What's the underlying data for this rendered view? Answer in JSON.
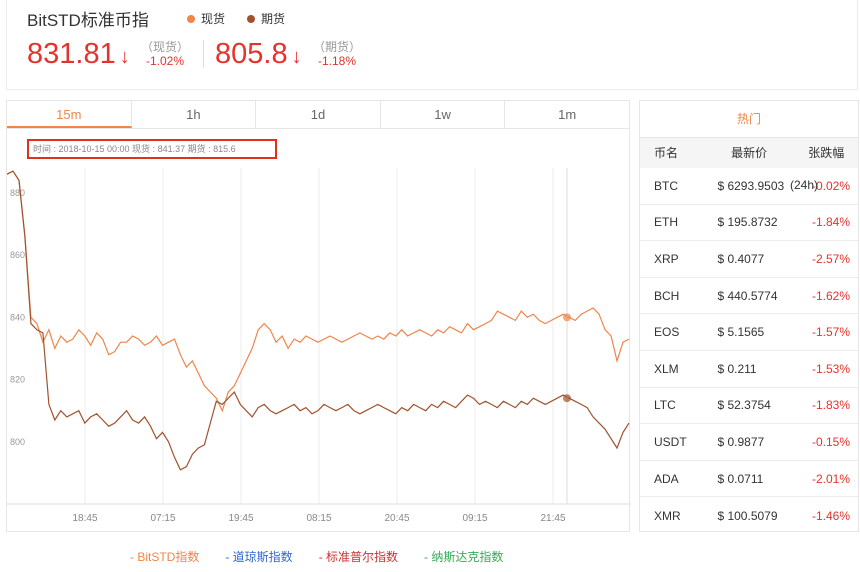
{
  "header": {
    "title": "BitSTD标准币指",
    "legend": [
      {
        "label": "现货",
        "color": "#f0844a"
      },
      {
        "label": "期货",
        "color": "#a0522d"
      }
    ],
    "spot": {
      "value": "831.81",
      "arrow": "↓",
      "label": "（现货）",
      "pct": "-1.02%"
    },
    "futures": {
      "value": "805.8",
      "arrow": "↓",
      "label": "（期货）",
      "pct": "-1.18%"
    }
  },
  "tabs": [
    {
      "label": "15m",
      "active": true
    },
    {
      "label": "1h",
      "active": false
    },
    {
      "label": "1d",
      "active": false
    },
    {
      "label": "1w",
      "active": false
    },
    {
      "label": "1m",
      "active": false
    }
  ],
  "tooltip": "时间 : 2018-10-15 00:00   现货 : 841.37   期货 : 815.6",
  "bottom_legend": [
    {
      "label": "-  BitSTD指数",
      "color": "#f0844a"
    },
    {
      "label": "-  道琼斯指数",
      "color": "#3366cc"
    },
    {
      "label": "-  标准普尔指数",
      "color": "#cc3333"
    },
    {
      "label": "-  纳斯达克指数",
      "color": "#33aa55"
    }
  ],
  "hot": {
    "title": "热门",
    "columns": [
      "币名",
      "最新价",
      "张跌幅"
    ],
    "volume_label": "(24h)",
    "rows": [
      {
        "name": "BTC",
        "price": "$ 6293.9503",
        "change": "-0.02%"
      },
      {
        "name": "ETH",
        "price": "$ 195.8732",
        "change": "-1.84%"
      },
      {
        "name": "XRP",
        "price": "$ 0.4077",
        "change": "-2.57%"
      },
      {
        "name": "BCH",
        "price": "$ 440.5774",
        "change": "-1.62%"
      },
      {
        "name": "EOS",
        "price": "$ 5.1565",
        "change": "-1.57%"
      },
      {
        "name": "XLM",
        "price": "$ 0.211",
        "change": "-1.53%"
      },
      {
        "name": "LTC",
        "price": "$ 52.3754",
        "change": "-1.83%"
      },
      {
        "name": "USDT",
        "price": "$ 0.9877",
        "change": "-0.15%"
      },
      {
        "name": "ADA",
        "price": "$ 0.0711",
        "change": "-2.01%"
      },
      {
        "name": "XMR",
        "price": "$ 100.5079",
        "change": "-1.46%"
      }
    ]
  },
  "chart_data": {
    "type": "line",
    "x_ticks": [
      "18:45",
      "07:15",
      "19:45",
      "08:15",
      "20:45",
      "09:15",
      "21:45"
    ],
    "y_ticks": [
      800,
      820,
      840,
      860,
      880
    ],
    "ylim": [
      780,
      888
    ],
    "grid": "vertical",
    "series": [
      {
        "name": "现货",
        "color": "#f0844a",
        "values": [
          886,
          887,
          884,
          866,
          840,
          838,
          832,
          836,
          830,
          834,
          832,
          833,
          836,
          834,
          831,
          835,
          833,
          828,
          829,
          832,
          832,
          834,
          833,
          831,
          832,
          834,
          831,
          832,
          833,
          828,
          824,
          826,
          822,
          818,
          816,
          814,
          810,
          816,
          818,
          822,
          826,
          830,
          836,
          838,
          836,
          832,
          834,
          830,
          833,
          832,
          834,
          833,
          832,
          833,
          834,
          833,
          832,
          833,
          834,
          835,
          834,
          833,
          834,
          833,
          835,
          834,
          836,
          834,
          835,
          836,
          835,
          834,
          836,
          835,
          837,
          836,
          835,
          838,
          836,
          837,
          838,
          839,
          842,
          841,
          840,
          839,
          842,
          840,
          841,
          839,
          838,
          839,
          840,
          841,
          840,
          839,
          841,
          842,
          843,
          841,
          836,
          834,
          826,
          832,
          833
        ]
      },
      {
        "name": "期货",
        "color": "#a0522d",
        "values": [
          886,
          887,
          884,
          866,
          838,
          836,
          835,
          812,
          807,
          810,
          808,
          809,
          810,
          806,
          808,
          809,
          807,
          805,
          806,
          808,
          810,
          807,
          806,
          808,
          805,
          801,
          803,
          800,
          795,
          791,
          792,
          796,
          798,
          799,
          806,
          813,
          812,
          814,
          816,
          812,
          810,
          808,
          811,
          812,
          810,
          809,
          810,
          811,
          812,
          810,
          811,
          809,
          810,
          812,
          811,
          810,
          811,
          812,
          810,
          809,
          810,
          811,
          812,
          811,
          810,
          809,
          811,
          810,
          812,
          811,
          810,
          812,
          811,
          813,
          812,
          811,
          813,
          815,
          814,
          812,
          813,
          812,
          811,
          813,
          812,
          811,
          813,
          812,
          814,
          813,
          812,
          813,
          814,
          815,
          814,
          813,
          812,
          811,
          808,
          806,
          804,
          801,
          798,
          803,
          806
        ]
      }
    ]
  }
}
